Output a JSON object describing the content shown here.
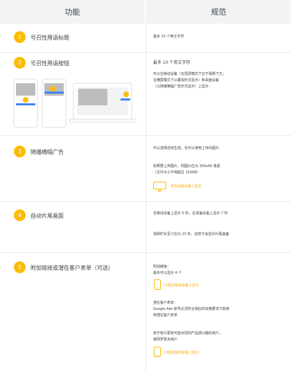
{
  "header": {
    "left": "功能",
    "right": "规范"
  },
  "rows": [
    {
      "num": "1",
      "title": "号召性用语标题",
      "spec": [
        "最多 15 个英文字符"
      ]
    },
    {
      "num": "2",
      "title": "号召性用语按钮",
      "spec": [
        "最多 10 个英文字符",
        "可以在移动设备（在竖屏模式下位于视频下方；",
        "在横屏模式下以叠加形式显示）和桌面设备",
        "（以随播横幅广告形式显示）上显示"
      ]
    },
    {
      "num": "3",
      "title": "随播横幅广告",
      "spec": [
        "可以选择自动生成，也可以使用上传的图片",
        "如果要上传图片，则图片应为 300x60 像素",
        "（文件大小不得超过 150KB）"
      ],
      "note": "仅在桌面设备上显示"
    },
    {
      "num": "4",
      "title": "自动片尾画面",
      "spec": [
        "在移动设备上显示 5 秒，在桌面设备上显示 7 秒",
        "视频时长至少应为 15 秒，这样才会显示片尾画面"
      ]
    },
    {
      "num": "5",
      "title": "附加链接或潜在客户表单（可选）",
      "spec_a": [
        "附加链接：",
        "最多可以显示 4 个"
      ],
      "note_a": "只能在移动设备上显示",
      "spec_b": [
        "潜在客户表单：",
        "Google Ads 帐号必须符合相应的资格要求才能使",
        "用潜在客户表单",
        "用于吸引更有可能对您的产品感兴趣的用户，",
        "或网罗更多用户"
      ],
      "note_b": "只能在移动设备上显示"
    }
  ],
  "colors": {
    "accent": "#fbbc04",
    "header_bg": "#f1f3f4",
    "divider": "#e8eaed",
    "placeholder": "#bdbdbd",
    "button_blue": "#4285f4"
  }
}
